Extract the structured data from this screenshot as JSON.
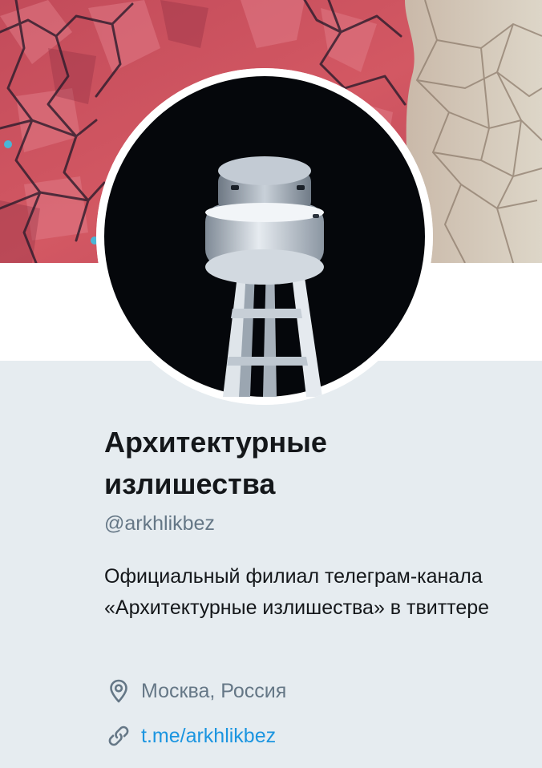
{
  "profile": {
    "display_name": "Архитектурные излишества",
    "screen_name": "@arkhlikbez",
    "bio": "Официальный филиал телеграм-канала «Архитектурные излишества» в твиттере",
    "location": "Москва, Россия",
    "url": "t.me/arkhlikbez"
  },
  "icons": {
    "location": "location-pin-icon",
    "link": "link-icon"
  },
  "colors": {
    "panel_background": "#e6ecf0",
    "primary_text": "#14171a",
    "secondary_text": "#657786",
    "link": "#1b95e0"
  }
}
